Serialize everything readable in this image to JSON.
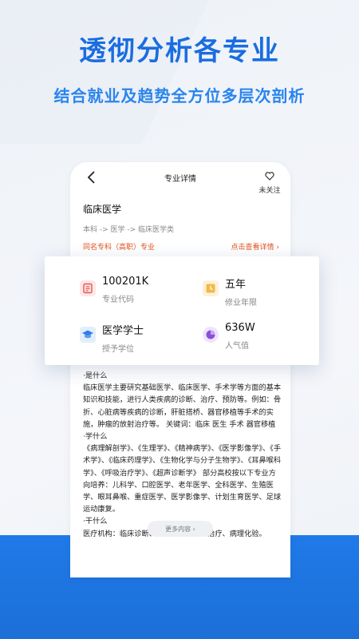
{
  "headline": "透彻分析各专业",
  "subline": "结合就业及趋势全方位多层次剖析",
  "navbar": {
    "title": "专业详情",
    "follow_label": "未关注"
  },
  "major": {
    "name": "临床医学",
    "breadcrumb": "本科 -> 医学 -> 临床医学类",
    "same_name_link": "同名专科（高职）专业",
    "detail_link": "点击查看详情 ›"
  },
  "stats": [
    {
      "value": "100201K",
      "label": "专业代码",
      "icon": "code-icon",
      "color": "#e8544f"
    },
    {
      "value": "五年",
      "label": "修业年限",
      "icon": "clock-icon",
      "color": "#f3b94a"
    },
    {
      "value": "医学学士",
      "label": "授予学位",
      "icon": "graduation-cap-icon",
      "color": "#2f7de8"
    },
    {
      "value": "636W",
      "label": "人气值",
      "icon": "pie-chart-icon",
      "color": "#8a4fd8"
    }
  ],
  "description": [
    "·是什么",
    "临床医学主要研究基础医学、临床医学、手术学等方面的基本知识和技能，进行人类疾病的诊断、治疗、预防等。例如：骨折、心脏病等疾病的诊断，肝脏搭桥、器官移植等手术的实施，肿瘤的放射治疗等。 关键词：临床 医生 手术 器官移植",
    "·学什么",
    "《病理解剖学》、《生理学》、《精神病学》、《医学影像学》、《手术学》、《临床药理学》、《生物化学与分子生物学》、《耳鼻喉科学》、《呼吸治疗学》、《超声诊断学》 部分高校按以下专业方向培养：儿科学、口腔医学、老年医学、全科医学、生殖医学、眼耳鼻喉、重症医学、医学影像学、计划生育医学、足球运动康复。",
    "·干什么",
    "医疗机构：临床诊断、手术治疗、临床治疗、病理化验。"
  ],
  "more_button": "更多内容 ›"
}
